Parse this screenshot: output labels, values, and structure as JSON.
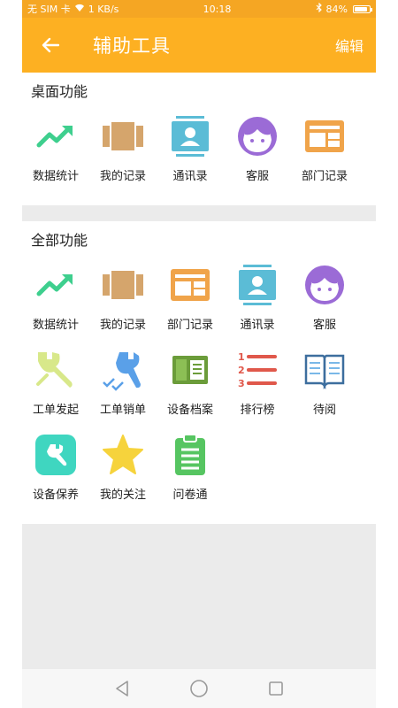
{
  "status": {
    "sim": "无 SIM 卡",
    "speed": "1 KB/s",
    "time": "10:18",
    "battery": "84%",
    "battery_level": 0.84
  },
  "header": {
    "title": "辅助工具",
    "edit_label": "编辑"
  },
  "desktop": {
    "title": "桌面功能",
    "items": [
      {
        "label": "数据统计",
        "icon": "trend-chart-icon"
      },
      {
        "label": "我的记录",
        "icon": "record-book-icon"
      },
      {
        "label": "通讯录",
        "icon": "contacts-icon"
      },
      {
        "label": "客服",
        "icon": "service-face-icon"
      },
      {
        "label": "部门记录",
        "icon": "department-records-icon"
      }
    ]
  },
  "all": {
    "title": "全部功能",
    "items": [
      {
        "label": "数据统计",
        "icon": "trend-chart-icon"
      },
      {
        "label": "我的记录",
        "icon": "record-book-icon"
      },
      {
        "label": "部门记录",
        "icon": "department-records-icon"
      },
      {
        "label": "通讯录",
        "icon": "contacts-icon"
      },
      {
        "label": "客服",
        "icon": "service-face-icon"
      },
      {
        "label": "工单发起",
        "icon": "wrench-start-icon"
      },
      {
        "label": "工单销单",
        "icon": "wrench-done-icon"
      },
      {
        "label": "设备档案",
        "icon": "device-file-icon"
      },
      {
        "label": "排行榜",
        "icon": "ranking-list-icon"
      },
      {
        "label": "待阅",
        "icon": "open-book-icon"
      },
      {
        "label": "设备保养",
        "icon": "maintenance-icon"
      },
      {
        "label": "我的关注",
        "icon": "star-icon"
      },
      {
        "label": "问卷通",
        "icon": "questionnaire-icon"
      }
    ]
  },
  "colors": {
    "status_bar": "#f5a623",
    "app_bar": "#fdb022",
    "divider_gray": "#ebebeb"
  }
}
